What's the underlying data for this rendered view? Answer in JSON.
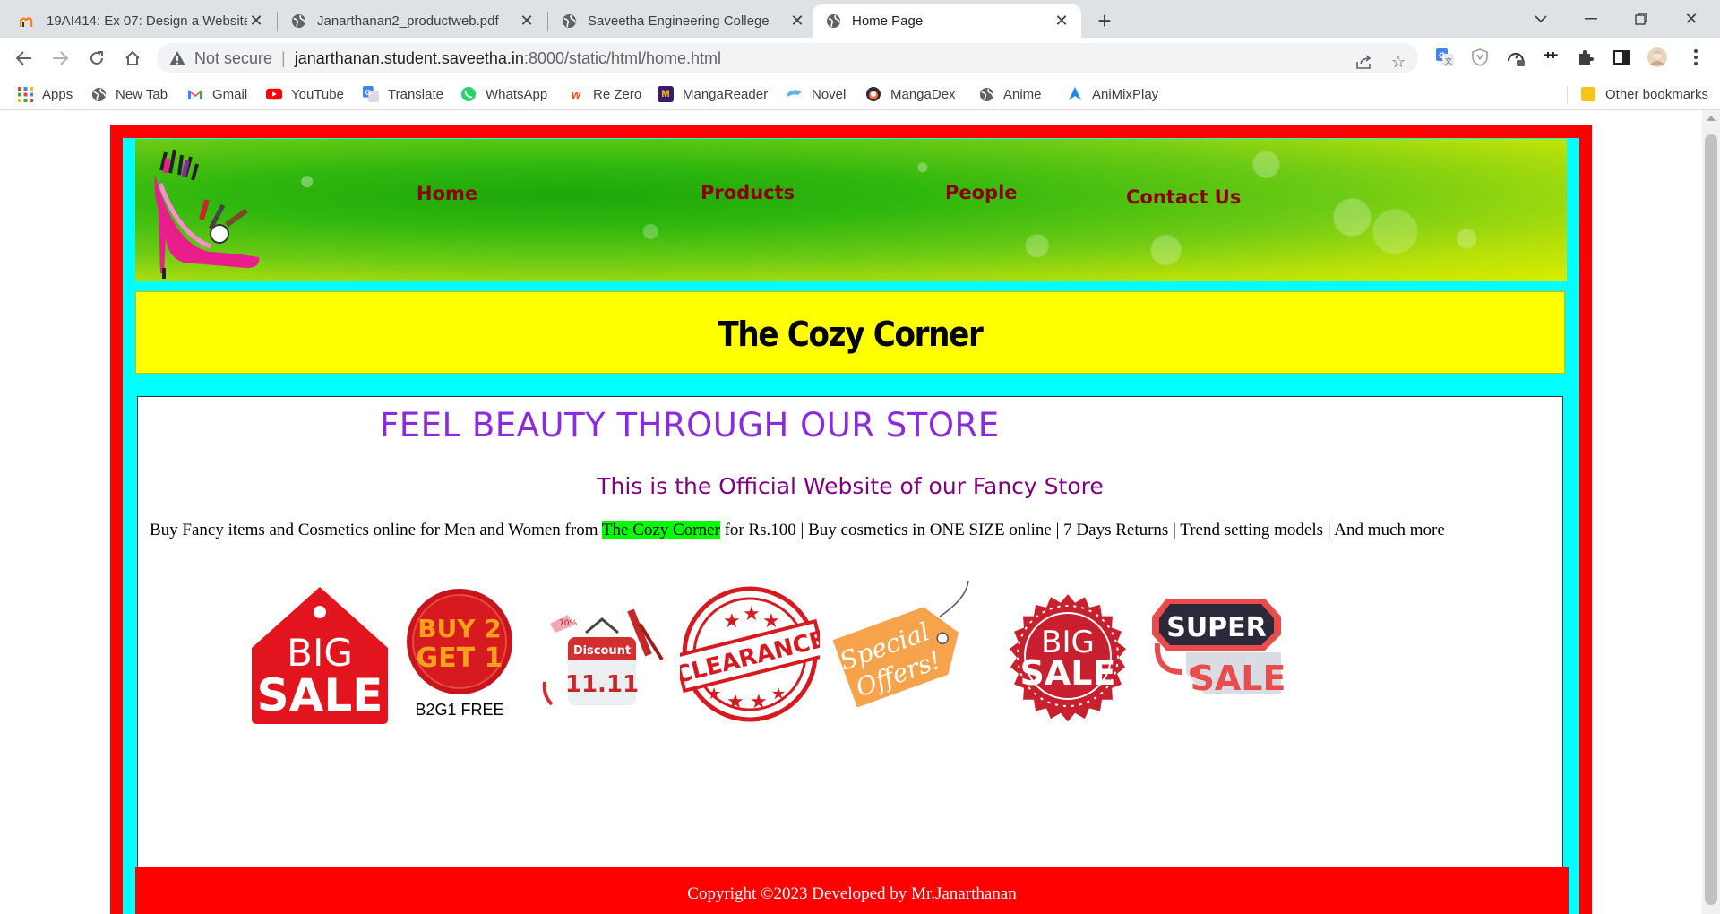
{
  "browser": {
    "tabs": [
      {
        "title": "19AI414: Ex 07: Design a Website",
        "icon": "moodle-icon"
      },
      {
        "title": "Janarthanan2_productweb.pdf",
        "icon": "globe-icon"
      },
      {
        "title": "Saveetha Engineering College",
        "icon": "globe-icon"
      },
      {
        "title": "Home Page",
        "icon": "globe-icon",
        "active": true
      }
    ],
    "address": {
      "security_label": "Not secure",
      "host": "janarthanan.student.saveetha.in",
      "path": ":8000/static/html/home.html"
    },
    "bookmarks": [
      {
        "label": "Apps",
        "icon": "apps-grid-icon"
      },
      {
        "label": "New Tab",
        "icon": "globe-icon"
      },
      {
        "label": "Gmail",
        "icon": "gmail-icon"
      },
      {
        "label": "YouTube",
        "icon": "youtube-icon"
      },
      {
        "label": "Translate",
        "icon": "translate-icon"
      },
      {
        "label": "WhatsApp",
        "icon": "whatsapp-icon"
      },
      {
        "label": "Re Zero",
        "icon": "rezero-icon"
      },
      {
        "label": "MangaReader",
        "icon": "mangareader-icon"
      },
      {
        "label": "Novel",
        "icon": "novel-icon"
      },
      {
        "label": "MangaDex",
        "icon": "mangadex-icon"
      },
      {
        "label": "Anime",
        "icon": "globe-icon"
      },
      {
        "label": "AniMixPlay",
        "icon": "animixplay-icon"
      }
    ],
    "other_bookmarks": "Other bookmarks"
  },
  "site": {
    "nav": [
      "Home",
      "Products",
      "People",
      "Contact Us"
    ],
    "store_name": "The Cozy Corner",
    "headline": "FEEL BEAUTY THROUGH OUR STORE",
    "subheadline": "This is the Official Website of our Fancy Store",
    "blurb": {
      "before": "Buy Fancy items and Cosmetics online for Men and Women from ",
      "highlight": "The Cozy Corner",
      "after": " for Rs.100 | Buy cosmetics in ONE SIZE online | 7 Days Returns | Trend setting models | And much more"
    },
    "badges": {
      "big_sale_1": [
        "BIG",
        "SALE"
      ],
      "buy2get1": [
        "BUY 2",
        "GET 1",
        "B2G1 FREE"
      ],
      "discount": [
        "Discount",
        "11.11",
        "70%"
      ],
      "clearance": "CLEARANCE",
      "special": [
        "Special",
        "Offers!"
      ],
      "big_sale_2": [
        "BIG",
        "SALE"
      ],
      "super_sale": [
        "SUPER",
        "SALE"
      ]
    },
    "footer": "Copyright ©2023 Developed by Mr.Janarthanan"
  },
  "colors": {
    "outer_border": "#ff0000",
    "inner_border": "#00ffff",
    "title_bg": "#ffff00",
    "nav_text": "#8b0000",
    "headline": "#8a2be2",
    "subheadline": "#800080",
    "highlight": "#00ff00"
  }
}
